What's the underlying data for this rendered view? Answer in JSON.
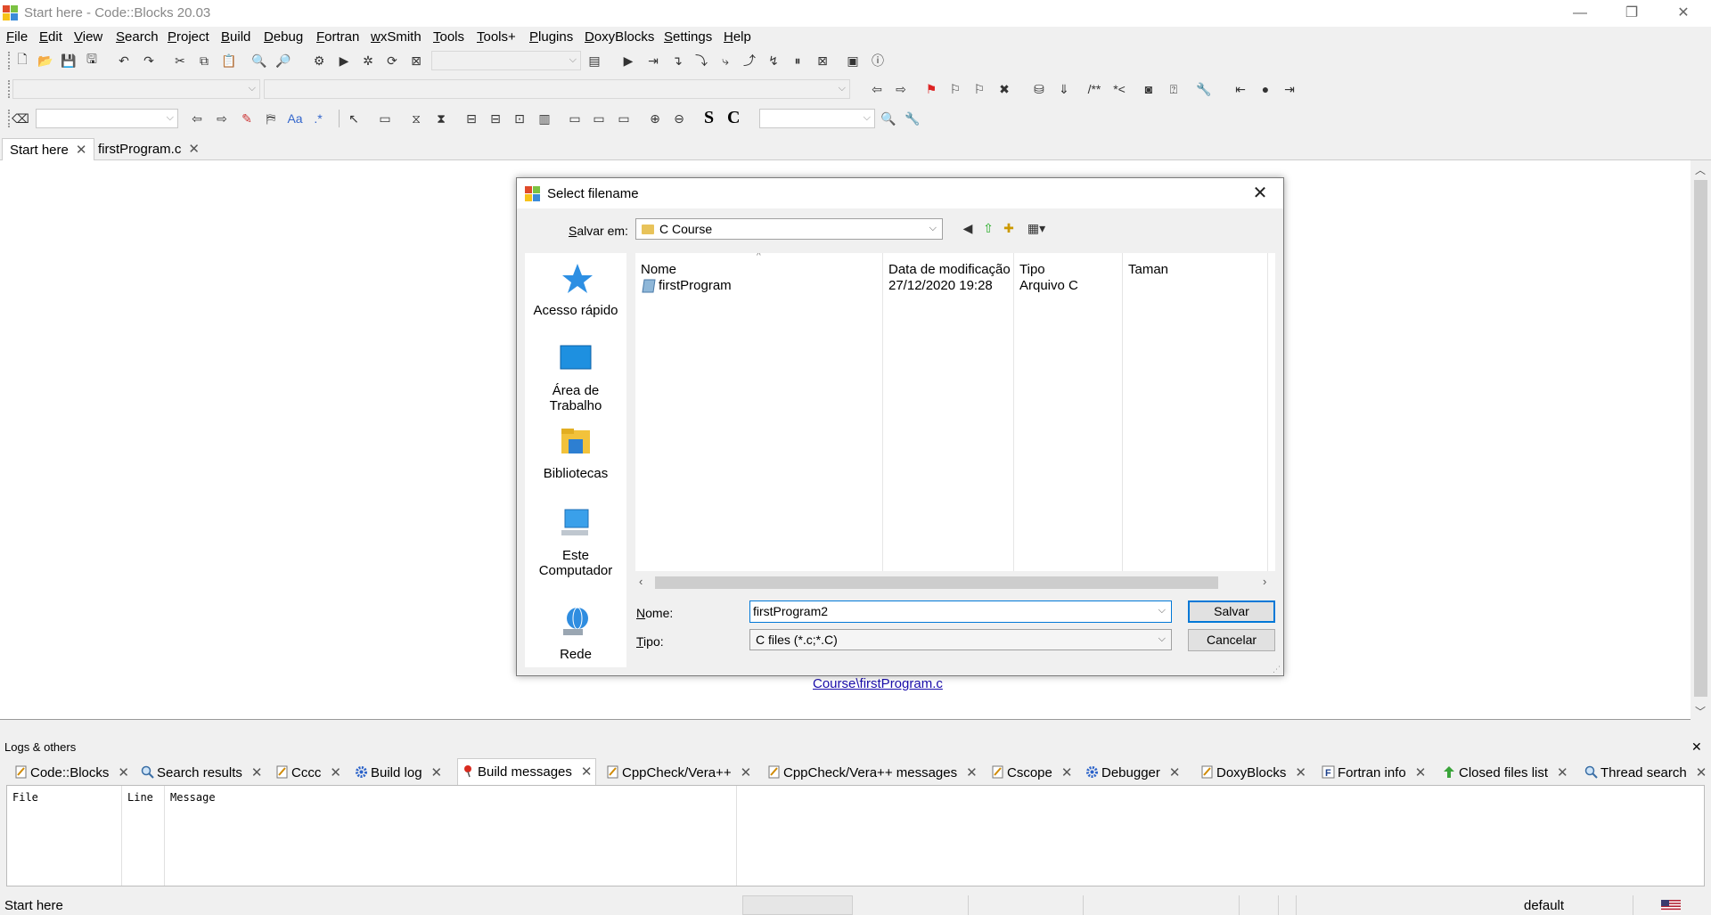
{
  "window": {
    "title": "Start here - Code::Blocks 20.03",
    "minimize": "—",
    "restore": "❐",
    "close": "✕"
  },
  "menu": [
    "File",
    "Edit",
    "View",
    "Search",
    "Project",
    "Build",
    "Debug",
    "Fortran",
    "wxSmith",
    "Tools",
    "Tools+",
    "Plugins",
    "DoxyBlocks",
    "Settings",
    "Help"
  ],
  "toolbar3": {
    "bold_s": "S",
    "bold_c": "C",
    "regex": ".*"
  },
  "editor_tabs": [
    {
      "label": "Start here",
      "close": "✕"
    },
    {
      "label": "firstProgram.c",
      "close": "✕"
    }
  ],
  "editor": {
    "link": "Course\\firstProgram.c"
  },
  "dialog": {
    "title": "Select filename",
    "close": "✕",
    "save_in_label": "Salvar em:",
    "save_in_value": "C Course",
    "places": [
      "Acesso rápido",
      "Área de Trabalho",
      "Bibliotecas",
      "Este Computador",
      "Rede"
    ],
    "columns": [
      "Nome",
      "Data de modificação",
      "Tipo",
      "Taman"
    ],
    "files": [
      {
        "name": "firstProgram",
        "date": "27/12/2020 19:28",
        "type": "Arquivo C"
      }
    ],
    "name_label": "Nome:",
    "name_value": "firstProgram2",
    "type_label": "Tipo:",
    "type_value": "C files (*.c;*.C)",
    "save_button": "Salvar",
    "cancel_button": "Cancelar"
  },
  "logs": {
    "title": "Logs & others",
    "close": "✕",
    "tabs": [
      "Code::Blocks",
      "Search results",
      "Cccc",
      "Build log",
      "Build messages",
      "CppCheck/Vera++",
      "CppCheck/Vera++ messages",
      "Cscope",
      "Debugger",
      "DoxyBlocks",
      "Fortran info",
      "Closed files list",
      "Thread search"
    ],
    "tab_close": "✕",
    "columns": [
      "File",
      "Line",
      "Message"
    ]
  },
  "status": {
    "left": "Start here",
    "encoding": "default"
  }
}
